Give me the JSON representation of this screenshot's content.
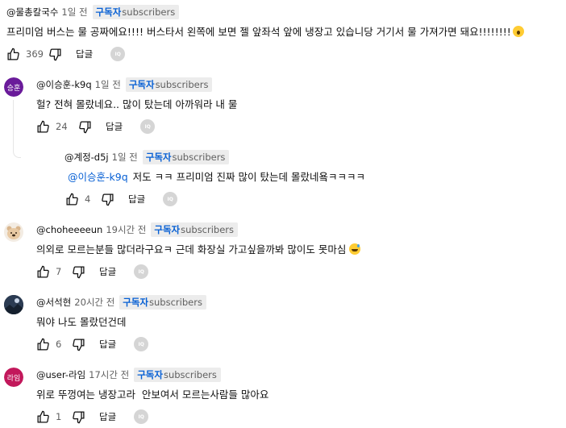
{
  "badge_sub": "구독자",
  "badge_word": "subscribers",
  "reply_label": "답글",
  "comments": [
    {
      "handle": "@물총칼국수",
      "time": "1일 전",
      "text": "프리미엄 버스는 물 공짜에요!!!! 버스타서 왼쪽에 보면 젤 앞좌석 앞에 냉장고 있습니당 거기서 물 가져가면 돼요!!!!!!!!",
      "likes": "369",
      "emoji": "astonished-face"
    },
    {
      "avatar_text": "승훈",
      "avatar_color": "#6a1b9a",
      "handle": "@이승훈-k9q",
      "time": "1일 전",
      "text": "헐? 전혀 몰랐네요.. 많이 탔는데 아까워라 내 물",
      "likes": "24"
    },
    {
      "handle": "@계정-d5j",
      "time": "1일 전",
      "mention": "@이승훈-k9q",
      "text": "저도 ㅋㅋ 프리미엄 진짜 많이 탔는데 몰랐네욬ㅋㅋㅋㅋ",
      "likes": "4"
    },
    {
      "avatar_icon": "teddy-bear-avatar",
      "handle": "@choheeeeun",
      "time": "19시간 전",
      "text": "의외로 모르는분들 많더라구요ㅋ 근데 화장실 가고싶을까봐 많이도 못마심",
      "likes": "7",
      "emoji": "grinning-sweat-face"
    },
    {
      "avatar_icon": "night-landscape-avatar",
      "handle": "@서석현",
      "time": "20시간 전",
      "text": "뭐야 나도 몰랐던건데",
      "likes": "6"
    },
    {
      "avatar_text": "라임",
      "avatar_color": "#c2185b",
      "handle": "@user-라임",
      "time": "17시간 전",
      "text": "위로 뚜껑여는 냉장고라  안보여서 모르는사람들 많아요",
      "likes": "1"
    }
  ]
}
